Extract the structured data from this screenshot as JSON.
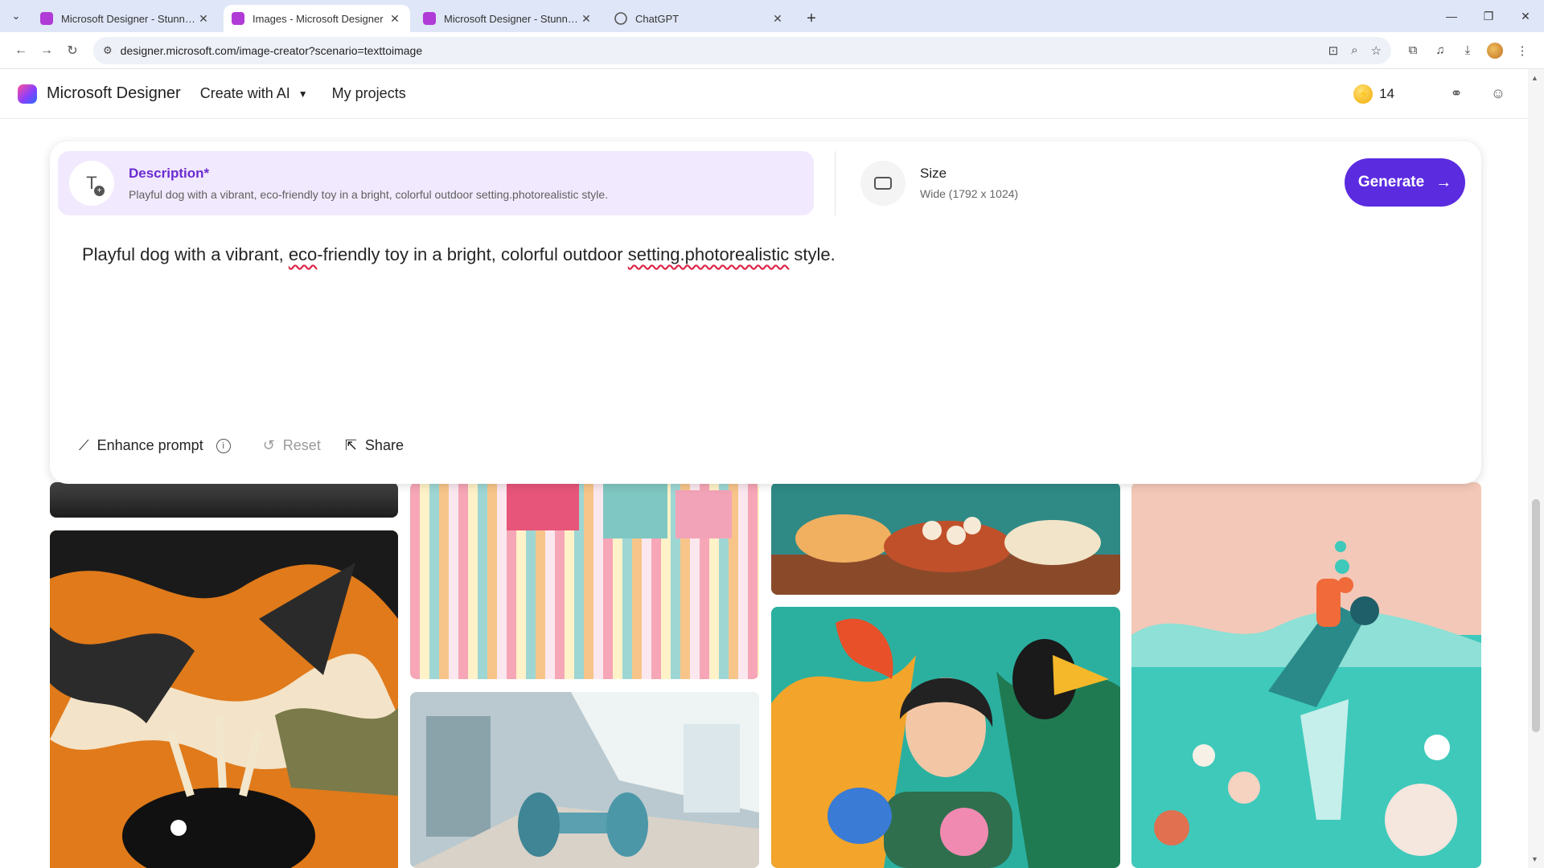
{
  "browser": {
    "tabs": [
      {
        "title": "Microsoft Designer - Stunning designs in a flash",
        "active": false
      },
      {
        "title": "Images - Microsoft Designer",
        "active": true
      },
      {
        "title": "Microsoft Designer - Stunning designs in a flash",
        "active": false
      },
      {
        "title": "ChatGPT",
        "active": false
      }
    ],
    "url": "designer.microsoft.com/image-creator?scenario=texttoimage"
  },
  "app": {
    "brand": "Microsoft Designer",
    "nav": {
      "create": "Create with AI",
      "projects": "My projects"
    },
    "credits": "14"
  },
  "prompt_card": {
    "description_title": "Description*",
    "description_summary": "Playful dog with a vibrant, eco-friendly toy in a bright, colorful outdoor setting.photorealistic style.",
    "size_title": "Size",
    "size_value": "Wide (1792 x 1024)",
    "generate_label": "Generate",
    "prompt": {
      "p1": "Playful dog with a vibrant, ",
      "w1": "eco",
      "p2": "-friendly toy in a bright, colorful outdoor ",
      "w2": "setting.photorealistic",
      "p3": " style."
    },
    "enhance_label": "Enhance prompt",
    "reset_label": "Reset",
    "share_label": "Share"
  },
  "colors": {
    "accent": "#5b2be0",
    "description_bg": "#f1e9fd"
  }
}
